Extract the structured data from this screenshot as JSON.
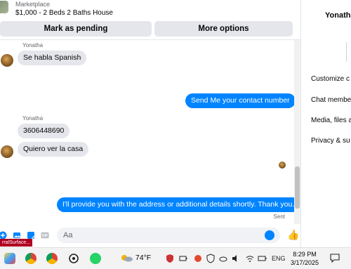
{
  "listing": {
    "category": "Marketplace",
    "title": "$1,000 - 2 Beds 2 Baths House"
  },
  "actions": {
    "pending_label": "Mark as pending",
    "more_label": "More options"
  },
  "messages": [
    {
      "sender": "Yonatha",
      "text": "Se habla Spanish",
      "direction": "in"
    },
    {
      "text": "Send Me your contact number",
      "direction": "out"
    },
    {
      "sender": "Yonatha",
      "text": "3606448690",
      "direction": "in"
    },
    {
      "text": "Quiero ver la casa",
      "direction": "in"
    },
    {
      "text": "I'll provide you with the address or additional details shortly. Thank you.",
      "direction": "out",
      "status": "Sent"
    }
  ],
  "composer": {
    "placeholder": "Aa"
  },
  "details": {
    "name": "Yonatha",
    "items": [
      "Customize c",
      "Chat membe",
      "Media, files a",
      "Privacy & su"
    ]
  },
  "taskbar": {
    "tooltip": "rralSurface...",
    "temperature": "74°F",
    "language": "ENG",
    "time": "8:29 PM",
    "date": "3/17/2025",
    "apps": [
      "paint-icon",
      "chrome-profile-icon",
      "chrome-icon",
      "chatgpt-icon",
      "whatsapp-icon"
    ]
  },
  "colors": {
    "outgoing": "#0084ff",
    "incoming": "#e4e6eb",
    "button": "#e4e6eb"
  }
}
